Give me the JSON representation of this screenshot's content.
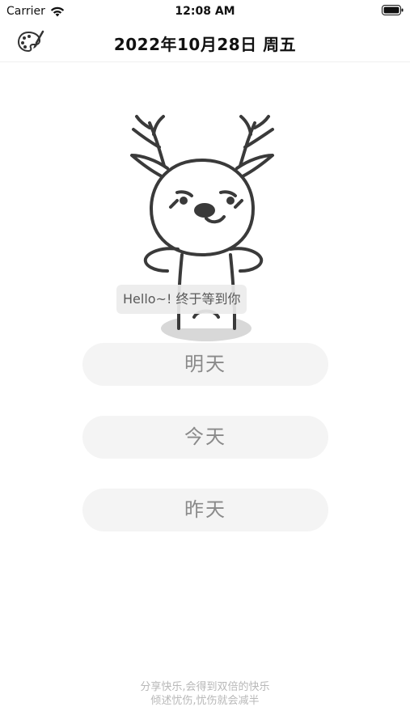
{
  "status_bar": {
    "carrier": "Carrier",
    "time": "12:08 AM"
  },
  "nav": {
    "title": "2022年10月28日  周五",
    "palette_icon": "palette-icon"
  },
  "mascot": {
    "icon": "deer-mascot",
    "greeting": "Hello~! 终于等到你"
  },
  "buttons": {
    "tomorrow": "明天",
    "today": "今天",
    "yesterday": "昨天"
  },
  "footer": {
    "line1": "分享快乐,会得到双倍的快乐",
    "line2": "倾述忧伤,忧伤就会减半"
  },
  "colors": {
    "button_bg": "#f4f4f4",
    "button_text": "#8a8a8a",
    "footer_text": "#b8b8b8"
  }
}
